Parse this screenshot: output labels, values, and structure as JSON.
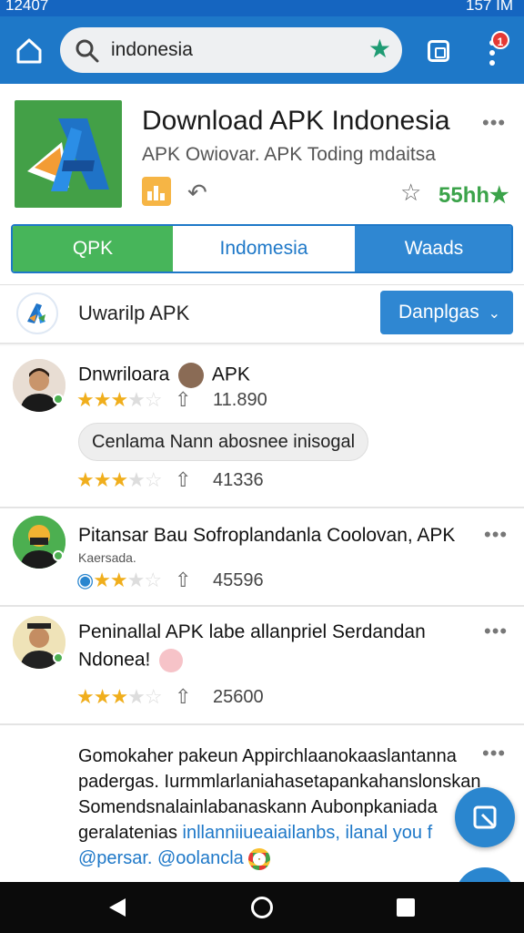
{
  "status": {
    "left": "12407",
    "right": "157 IM"
  },
  "search": {
    "value": "indonesia"
  },
  "app": {
    "title": "Download APK Indonesia",
    "subtitle": "APK Owiovar. APK Toding mdaitsa",
    "rating": "55hh★"
  },
  "segments": [
    "QPK",
    "Indomesia",
    "Waads"
  ],
  "subheader": {
    "title": "Uwarilp APK",
    "dropdown": "Danplgas"
  },
  "badge": {
    "count": "1"
  },
  "feed": [
    {
      "name_part1": "Dnwriloara",
      "name_part2": "APK",
      "count1": "11.890",
      "pill": "Cenlama Nann abosnee inisogal",
      "count2": "41336",
      "stars": 3.5
    },
    {
      "name": "Pitansar Bau Sofroplandanla Coolovan, APK",
      "subtext": "Kaersada.",
      "count": "45596",
      "stars": 3.5
    },
    {
      "name_line1": "Peninallal APK labe allanpriel Serdandan",
      "name_line2": "Ndonea!",
      "count": "25600",
      "stars": 3.5
    },
    {
      "lines": [
        "Gomokaher pakeun Appirchlaanokaaslantanna",
        "padergas. Iurmmlarlaniahasetapankahanslonskan",
        "Somendsnalainlabanaskann Aubonpkaniada"
      ],
      "line4_black": "geralatenias",
      "line4_blue": "inllanniiueaiailanbs, ilanal you f",
      "mentions": "@persar. @oolancla"
    }
  ]
}
